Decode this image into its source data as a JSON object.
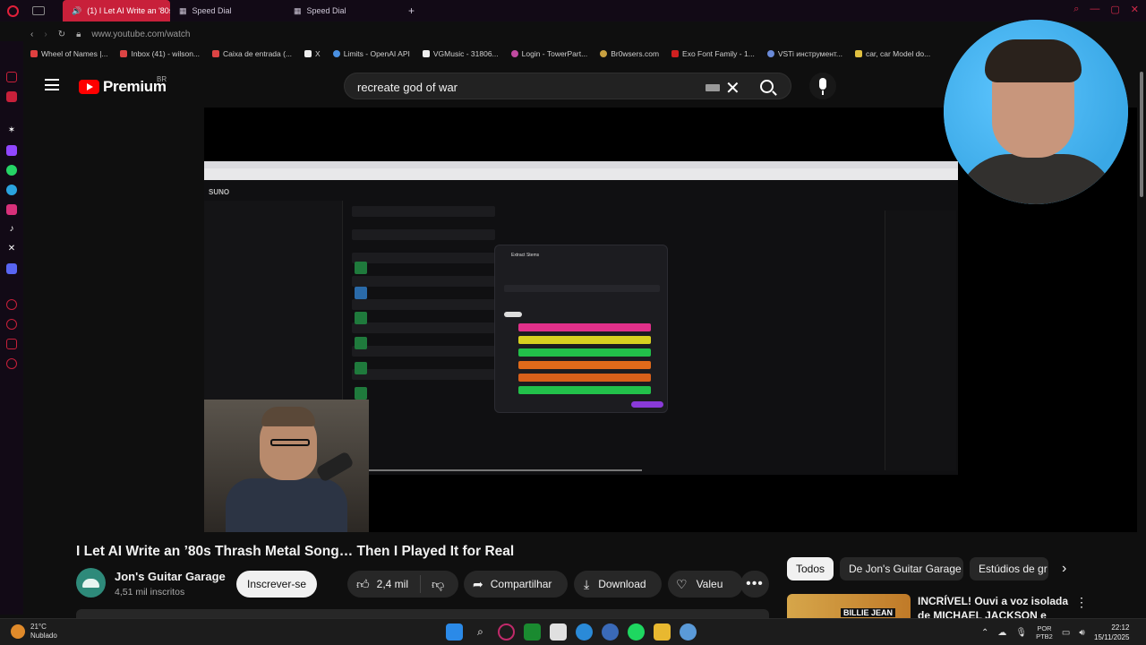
{
  "browser": {
    "tabs": [
      {
        "label": "(1) I Let AI Write an '80s",
        "active": true
      },
      {
        "label": "Speed Dial",
        "active": false
      },
      {
        "label": "Speed Dial",
        "active": false
      }
    ],
    "new_tab": "+",
    "url": "www.youtube.com/watch",
    "bookmarks": [
      "Wheel of Names |...",
      "Inbox (41) - wilson...",
      "Caixa de entrada (...",
      "X",
      "Limits - OpenAI API",
      "VGMusic - 31806...",
      "Login - TowerPart...",
      "Br0wsers.com",
      "Exo Font Family - 1...",
      "VSTi инструмент...",
      "car, car Model do..."
    ]
  },
  "youtube": {
    "logo_text": "Premium",
    "region": "BR",
    "search_value": "recreate god of war",
    "video": {
      "title": "I Let AI Write an ’80s Thrash Metal Song… Then I Played It for Real",
      "inner_app_label": "SUNO",
      "inner_modal_title": "Extract Stems"
    },
    "channel": {
      "name": "Jon's Guitar Garage",
      "subscribers": "4,51 mil inscritos",
      "subscribe_label": "Inscrever-se",
      "avatar_text": "GARAGE"
    },
    "actions": {
      "likes": "2,4 mil",
      "share": "Compartilhar",
      "download": "Download",
      "thanks": "Valeu",
      "more": "•••"
    },
    "chips": [
      "Todos",
      "De Jon's Guitar Garage",
      "Estúdios de gr"
    ],
    "suggestion": {
      "title": "INCRÍVEL! Ouvi a voz isolada de MICHAEL JACKSON e fiquei",
      "thumb_badge": "BILLIE JEAN"
    }
  },
  "taskbar": {
    "weather_temp": "21°C",
    "weather_desc": "Nublado",
    "lang": "POR",
    "lang2": "PTB2",
    "time": "22:12",
    "date": "15/11/2025"
  },
  "colors": {
    "opera_red": "#e0203a",
    "yt_red": "#ff0000",
    "bg": "#0f0f0f",
    "stem_colors": [
      "#e0308a",
      "#d8d020",
      "#22c04a",
      "#e06a1a",
      "#d8601a",
      "#22c04a"
    ]
  }
}
